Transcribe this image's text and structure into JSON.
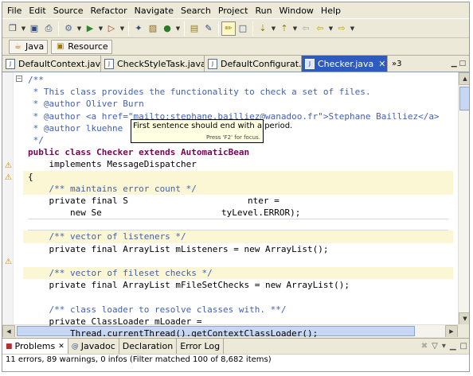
{
  "menu": [
    "File",
    "Edit",
    "Source",
    "Refactor",
    "Navigate",
    "Search",
    "Project",
    "Run",
    "Window",
    "Help"
  ],
  "toolbar": {
    "icons": [
      "new-icon",
      "save-icon",
      "print-icon",
      "debug-icon",
      "run-icon",
      "external-tools-icon",
      "new-java-project-icon",
      "new-package-icon",
      "new-class-icon",
      "open-type-icon",
      "search-icon",
      "toggle-mark-occurrences-icon",
      "show-whitespace-icon",
      "next-annotation-icon",
      "previous-annotation-icon",
      "back-icon",
      "forward-icon"
    ]
  },
  "perspectives": [
    {
      "label": "Java",
      "icon": "java-perspective-icon"
    },
    {
      "label": "Resource",
      "icon": "resource-perspective-icon"
    }
  ],
  "tabs": [
    {
      "label": "DefaultContext.java",
      "active": false
    },
    {
      "label": "CheckStyleTask.java",
      "active": false
    },
    {
      "label": "DefaultConfigurat...",
      "active": false
    },
    {
      "label": "Checker.java",
      "active": true
    }
  ],
  "tabs_overflow": "»3",
  "code": [
    "/**",
    " * This class provides the functionality to check a set of files.",
    " * @author Oliver Burn",
    " * @author <a href=\"mailto:stephane.bailliez@wanadoo.fr\">Stephane Bailliez</a>",
    " * @author lkuehne",
    " */",
    "public class Checker extends AutomaticBean",
    "    implements MessageDispatcher",
    "{",
    "    /** maintains error count */",
    "    private final S",
    "        new Se",
    "",
    "    /** vector of listeners */",
    "    private final ArrayList mListeners = new ArrayList();",
    "",
    "    /** vector of fileset checks */",
    "    private final ArrayList mFileSetChecks = new ArrayList();",
    "",
    "    /** class loader to resolve classes with. **/",
    "    private ClassLoader mLoader =",
    "        Thread.currentThread().getContextClassLoader();"
  ],
  "code_tail": {
    "line10": "nter =",
    "line11": "tyLevel.ERROR);"
  },
  "tooltip": {
    "message": "First sentence should end with a period.",
    "hint": "Press 'F2' for focus."
  },
  "bottom_tabs": [
    {
      "label": "Problems",
      "active": true
    },
    {
      "label": "Javadoc",
      "active": false
    },
    {
      "label": "Declaration",
      "active": false
    },
    {
      "label": "Error Log",
      "active": false
    }
  ],
  "status": "11 errors, 89 warnings, 0 infos (Filter matched 100 of 8,682 items)"
}
